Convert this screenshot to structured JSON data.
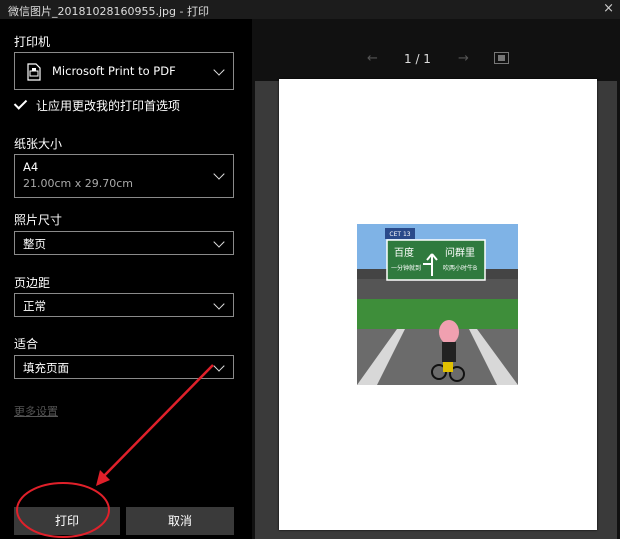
{
  "window": {
    "title": "微信图片_20181028160955.jpg - 打印",
    "close": "×"
  },
  "printer": {
    "label": "打印机",
    "value": "Microsoft Print to PDF"
  },
  "allow_app_prefs": {
    "label": "让应用更改我的打印首选项",
    "checked": true
  },
  "paper_size": {
    "label": "纸张大小",
    "value": "A4",
    "detail": "21.00cm x 29.70cm"
  },
  "photo_size": {
    "label": "照片尺寸",
    "value": "整页"
  },
  "margins": {
    "label": "页边距",
    "value": "正常"
  },
  "fit": {
    "label": "适合",
    "value": "填充页面"
  },
  "more_settings": "更多设置",
  "buttons": {
    "print": "打印",
    "cancel": "取消"
  },
  "preview": {
    "page_info": "1 / 1",
    "prev": "←",
    "next": "→"
  },
  "sign": {
    "left_place": "百度",
    "left_sub": "一分钟就到",
    "right_place": "问群里",
    "right_sub": "吹两小时牛B",
    "top_plate": "CET 13"
  },
  "colors": {
    "panel_bg": "#000000",
    "field_border": "#8a8a8a",
    "button_bg": "#3a3a3a",
    "annotation": "#e0202a"
  }
}
